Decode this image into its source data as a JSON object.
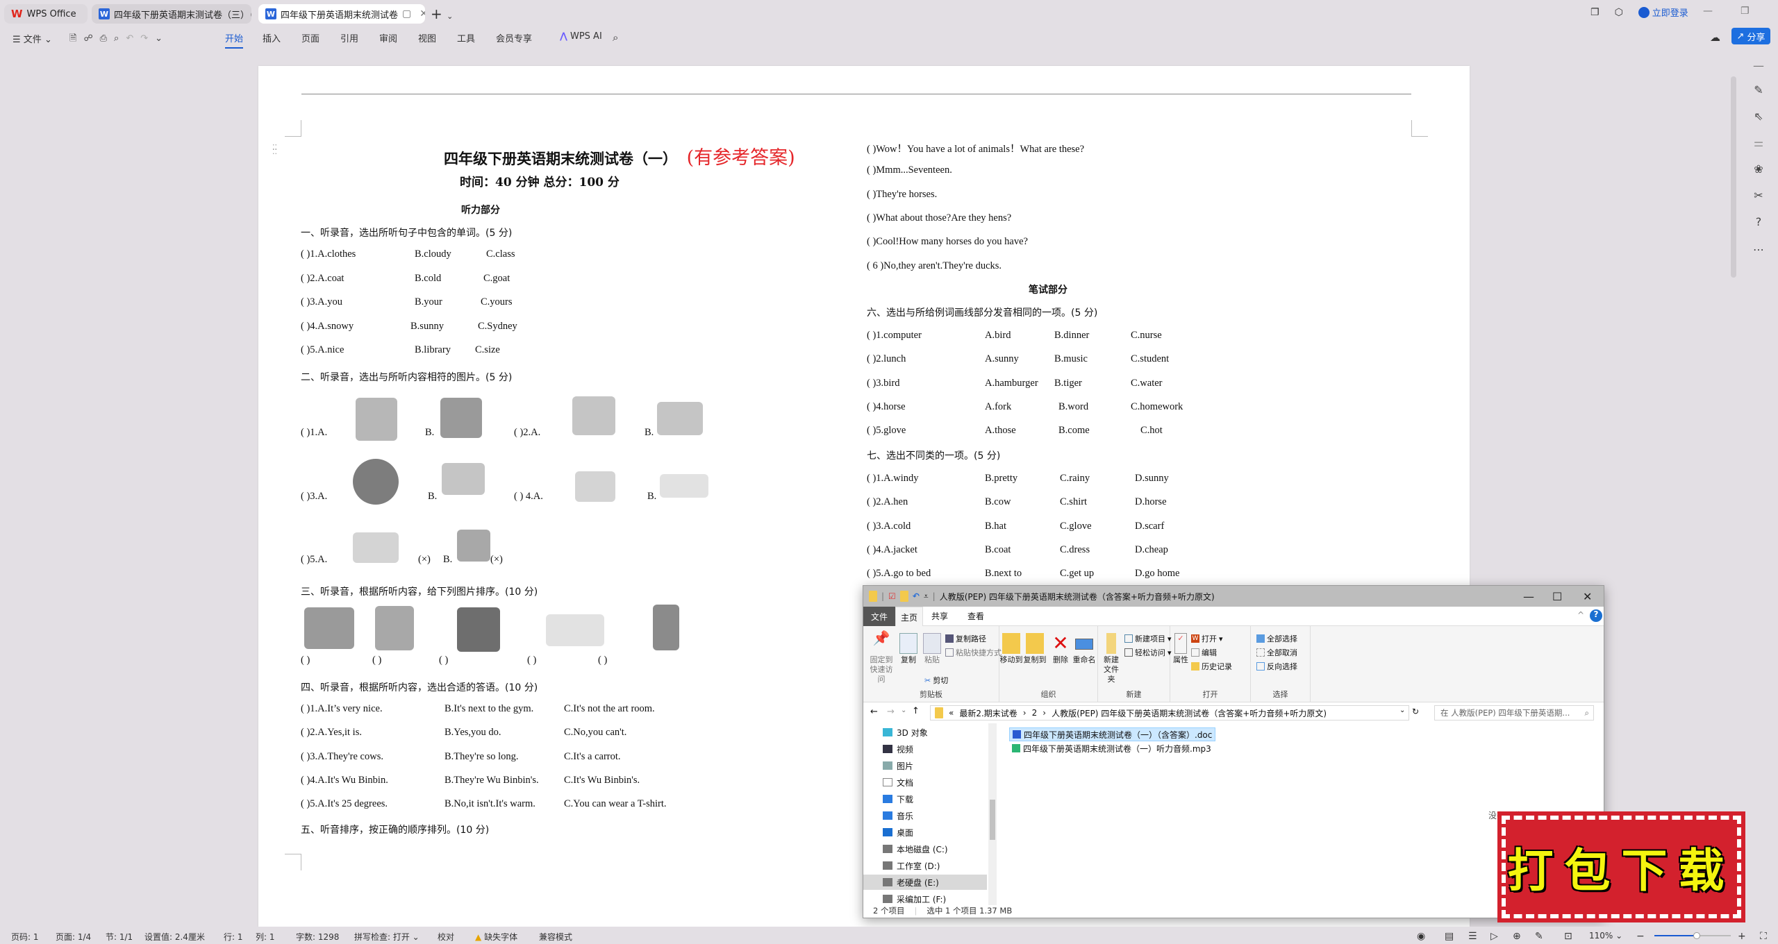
{
  "tabs": {
    "home": "WPS Office",
    "items": [
      {
        "label": "四年级下册英语期末测试卷（三）（有",
        "active": false
      },
      {
        "label": "四年级下册英语期末统测试卷",
        "active": true
      }
    ]
  },
  "titlebar": {
    "login": "立即登录"
  },
  "toolbar": {
    "file_menu": "文件",
    "menu_tabs": [
      "开始",
      "插入",
      "页面",
      "引用",
      "审阅",
      "视图",
      "工具",
      "会员专享"
    ],
    "active_tab": "开始",
    "wps_ai": "WPS AI",
    "share": "分享"
  },
  "document": {
    "title": "四年级下册英语期末统测试卷（一）",
    "title_note": "(有参考答案)",
    "subtitle": "时间：40 分钟    总分：100 分",
    "listening_heading": "听力部分",
    "section1": {
      "heading": "一、听录音，选出所听句子中包含的单词。(5 分)",
      "items": [
        {
          "q": "(        )1.A.clothes",
          "b": "B.cloudy",
          "c": "C.class"
        },
        {
          "q": "(        )2.A.coat",
          "b": "B.cold",
          "c": "C.goat"
        },
        {
          "q": "(        )3.A.you",
          "b": "B.your",
          "c": "C.yours"
        },
        {
          "q": "(        )4.A.snowy",
          "b": "B.sunny",
          "c": "C.Sydney"
        },
        {
          "q": "(        )5.A.nice",
          "b": "B.library",
          "c": "C.size"
        }
      ]
    },
    "section2": {
      "heading": "二、听录音，选出与所听内容相符的图片。(5 分)",
      "labels": [
        "(        )1.A.",
        "B.",
        "(        )2.A.",
        "B.",
        "(        )3.A.",
        "B.",
        "(        ) 4.A.",
        "B.",
        "(        )5.A.",
        "(×)",
        "B.",
        "(×)"
      ]
    },
    "section3": {
      "heading": "三、听录音，根据所听内容，给下列图片排序。(10 分)",
      "blanks": [
        "(      )",
        "(      )",
        "(      )",
        "(      )",
        "(      )"
      ]
    },
    "section4": {
      "heading": "四、听录音，根据所听内容，选出合适的答语。(10 分)",
      "items": [
        {
          "a": "(       )1.A.It’s very nice.",
          "b": "B.It's next to the gym.",
          "c": "C.It's not the art room."
        },
        {
          "a": "(       )2.A.Yes,it is.",
          "b": "B.Yes,you do.",
          "c": "C.No,you can't."
        },
        {
          "a": "(       )3.A.They're cows.",
          "b": "B.They're so long.",
          "c": "C.It's a carrot."
        },
        {
          "a": "(       )4.A.It's Wu Binbin.",
          "b": "B.They're Wu Binbin's.",
          "c": "C.It's Wu Binbin's."
        },
        {
          "a": "(       )5.A.It's 25 degrees.",
          "b": "B.No,it isn't.It's warm.",
          "c": "C.You can wear a T-shirt."
        }
      ]
    },
    "section5": {
      "heading": "五、听音排序，按正确的顺序排列。(10 分)",
      "items": [
        "(          )Wow！You have a lot of animals！What are these?",
        "(          )Mmm...Seventeen.",
        "(          )They're horses.",
        "(          )What about those?Are they hens?",
        "(          )Cool!How many horses do you have?",
        "(    6    )No,they aren't.They're ducks."
      ]
    },
    "written_heading": "笔试部分",
    "section6": {
      "heading": "六、选出与所给例词画线部分发音相同的一项。(5 分)",
      "items": [
        {
          "q": "(       )1.computer",
          "a": "A.bird",
          "b": "B.dinner",
          "c": "C.nurse"
        },
        {
          "q": "(       )2.lunch",
          "a": "A.sunny",
          "b": "B.music",
          "c": "C.student"
        },
        {
          "q": "(       )3.bird",
          "a": "A.hamburger",
          "b": "B.tiger",
          "c": "C.water"
        },
        {
          "q": "(       )4.horse",
          "a": "A.fork",
          "b": "B.word",
          "c": "C.homework"
        },
        {
          "q": "(       )5.glove",
          "a": "A.those",
          "b": "B.come",
          "c": "C.hot"
        }
      ]
    },
    "section7": {
      "heading": "七、选出不同类的一项。(5 分)",
      "items": [
        {
          "a": "(        )1.A.windy",
          "b": "B.pretty",
          "c": "C.rainy",
          "d": "D.sunny"
        },
        {
          "a": "(        )2.A.hen",
          "b": "B.cow",
          "c": "C.shirt",
          "d": "D.horse"
        },
        {
          "a": "(        )3.A.cold",
          "b": "B.hat",
          "c": "C.glove",
          "d": "D.scarf"
        },
        {
          "a": "(        )4.A.jacket",
          "b": "B.coat",
          "c": "C.dress",
          "d": "D.cheap"
        },
        {
          "a": "(        )5.A.go to bed",
          "b": "B.next to",
          "c": "C.get up",
          "d": "D.go home"
        }
      ]
    }
  },
  "explorer": {
    "title": "人教版(PEP) 四年级下册英语期末统测试卷（含答案+听力音频+听力原文)",
    "tabs": {
      "file": "文件",
      "home": "主页",
      "share": "共享",
      "view": "查看"
    },
    "ribbon": {
      "pin": "固定到快速访问",
      "copy": "复制",
      "paste": "粘贴",
      "copy_path": "复制路径",
      "paste_shortcut": "粘贴快捷方式",
      "cut": "剪切",
      "clipboard": "剪贴板",
      "move_to": "移动到",
      "copy_to": "复制到",
      "delete": "删除",
      "rename": "重命名",
      "organize": "组织",
      "new_folder": "新建文件夹",
      "new_item": "新建项目",
      "easy_access": "轻松访问",
      "new": "新建",
      "properties": "属性",
      "open": "打开",
      "edit": "编辑",
      "history": "历史记录",
      "open_group": "打开",
      "select_all": "全部选择",
      "select_none": "全部取消",
      "invert": "反向选择",
      "select_group": "选择"
    },
    "breadcrumb": [
      "«",
      "最新2.期末试卷",
      "›",
      "2",
      "›",
      "人教版(PEP) 四年级下册英语期末统测试卷（含答案+听力音频+听力原文)"
    ],
    "search_placeholder": "在 人教版(PEP) 四年级下册英语期...",
    "nav": [
      "3D 对象",
      "视频",
      "图片",
      "文档",
      "下载",
      "音乐",
      "桌面",
      "本地磁盘 (C:)",
      "工作室 (D:)",
      "老硬盘 (E:)",
      "采编加工 (F:)"
    ],
    "nav_selected": "老硬盘 (E:)",
    "files": [
      {
        "name": "四年级下册英语期末统测试卷（一）（含答案）.doc",
        "selected": true
      },
      {
        "name": "四年级下册英语期末统测试卷（一）听力音频.mp3",
        "selected": false
      }
    ],
    "preview": "没有预览。",
    "status": {
      "count": "2 个项目",
      "selected": "选中 1 个项目  1.37 MB"
    }
  },
  "stamp": "打包下载",
  "statusbar": {
    "page_num": "页码: 1",
    "pages": "页面: 1/4",
    "section": "节: 1/1",
    "setting": "设置值: 2.4厘米",
    "row": "行: 1",
    "col": "列: 1",
    "words": "字数: 1298",
    "spell": "拼写检查: 打开",
    "proof": "校对",
    "missing_font": "缺失字体",
    "compat": "兼容模式",
    "zoom": "110%",
    "zoom_fraction": 0.55
  }
}
